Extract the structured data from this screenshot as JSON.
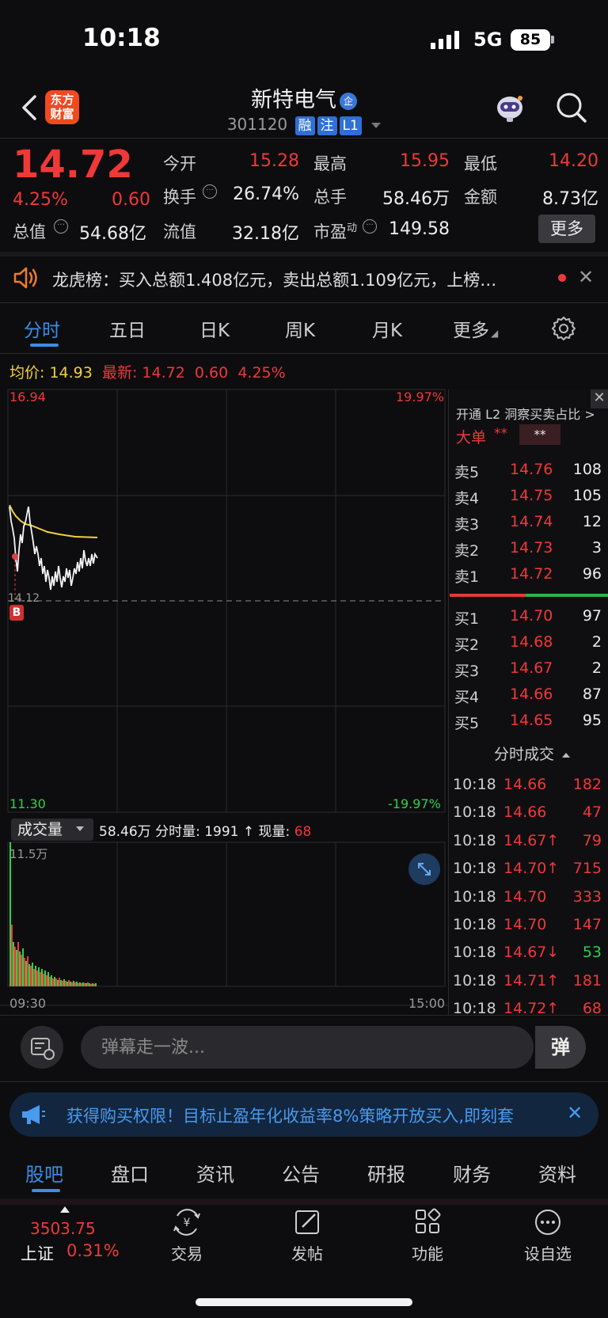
{
  "status": {
    "time": "10:18",
    "network": "5G",
    "battery": "85"
  },
  "header": {
    "logo_line1": "东方",
    "logo_line2": "财富",
    "stock_name": "新特电气",
    "enterprise_badge": "企",
    "stock_code": "301120",
    "tags": [
      "融",
      "注",
      "L1"
    ]
  },
  "quote": {
    "price": "14.72",
    "change_pct": "4.25%",
    "change": "0.60",
    "open_label": "今开",
    "open": "15.28",
    "high_label": "最高",
    "high": "15.95",
    "low_label": "最低",
    "low": "14.20",
    "turnover_label": "换手",
    "turnover": "26.74%",
    "volume_label": "总手",
    "volume": "58.46万",
    "amount_label": "金额",
    "amount": "8.73亿",
    "market_cap_label": "总值",
    "market_cap": "54.68亿",
    "float_cap_label": "流值",
    "float_cap": "32.18亿",
    "pe_label": "市盈",
    "pe_sup": "动",
    "pe": "149.58",
    "more_label": "更多"
  },
  "dragon_tiger": {
    "text": "龙虎榜：买入总额1.408亿元，卖出总额1.109亿元，上榜…"
  },
  "period_tabs": [
    "分时",
    "五日",
    "日K",
    "周K",
    "月K",
    "更多"
  ],
  "info_line": {
    "avg_label": "均价:",
    "avg": "14.93",
    "latest_label": "最新:",
    "latest": "14.72",
    "chg": "0.60",
    "pct": "4.25%"
  },
  "chart": {
    "y_max": "16.94",
    "y_max_pct": "19.97%",
    "y_min": "11.30",
    "y_min_pct": "-19.97%",
    "y_ref": "14.12",
    "b_marker": "B",
    "vol_select": "成交量",
    "vol_total": "58.46万",
    "vol_minute_label": "分时量:",
    "vol_minute": "1991",
    "vol_now_label": "现量:",
    "vol_now": "68",
    "vol_max": "11.5万",
    "time_start": "09:30",
    "time_end": "15:00"
  },
  "order_book": {
    "l2_promo": "开通 L2 洞察买卖占比 >",
    "big_order_label": "大单",
    "big_order_a": "**",
    "big_order_b": "**",
    "asks": [
      {
        "label": "卖5",
        "price": "14.76",
        "vol": "108"
      },
      {
        "label": "卖4",
        "price": "14.75",
        "vol": "105"
      },
      {
        "label": "卖3",
        "price": "14.74",
        "vol": "12"
      },
      {
        "label": "卖2",
        "price": "14.73",
        "vol": "3"
      },
      {
        "label": "卖1",
        "price": "14.72",
        "vol": "96"
      }
    ],
    "bids": [
      {
        "label": "买1",
        "price": "14.70",
        "vol": "97"
      },
      {
        "label": "买2",
        "price": "14.68",
        "vol": "2"
      },
      {
        "label": "买3",
        "price": "14.67",
        "vol": "2"
      },
      {
        "label": "买4",
        "price": "14.66",
        "vol": "87"
      },
      {
        "label": "买5",
        "price": "14.65",
        "vol": "95"
      }
    ],
    "trades_title": "分时成交",
    "trades": [
      {
        "time": "10:18",
        "price": "14.66",
        "vol": "182",
        "dir": "",
        "color": "#f03838"
      },
      {
        "time": "10:18",
        "price": "14.66",
        "vol": "47",
        "dir": "",
        "color": "#f03838"
      },
      {
        "time": "10:18",
        "price": "14.67↑",
        "vol": "79",
        "dir": "up",
        "color": "#f03838"
      },
      {
        "time": "10:18",
        "price": "14.70↑",
        "vol": "715",
        "dir": "up",
        "color": "#f03838"
      },
      {
        "time": "10:18",
        "price": "14.70",
        "vol": "333",
        "dir": "",
        "color": "#f03838"
      },
      {
        "time": "10:18",
        "price": "14.70",
        "vol": "147",
        "dir": "",
        "color": "#f03838"
      },
      {
        "time": "10:18",
        "price": "14.67↓",
        "vol": "53",
        "dir": "down",
        "color": "#2ed04a"
      },
      {
        "time": "10:18",
        "price": "14.71↑",
        "vol": "181",
        "dir": "up",
        "color": "#f03838"
      },
      {
        "time": "10:18",
        "price": "14.72↑",
        "vol": "68",
        "dir": "up",
        "color": "#f03838"
      }
    ]
  },
  "danmaku": {
    "placeholder": "弹幕走一波...",
    "send": "弹"
  },
  "promo": {
    "text": "获得购买权限！目标止盈年化收益率8%策略开放买入,即刻套"
  },
  "bottom_tabs": [
    "股吧",
    "盘口",
    "资讯",
    "公告",
    "研报",
    "财务",
    "资料"
  ],
  "bottom_nav": {
    "index_value": "3503.75",
    "index_name": "上证",
    "index_pct": "0.31%",
    "items": [
      "交易",
      "发帖",
      "功能",
      "设自选"
    ]
  },
  "colors": {
    "up": "#f03838",
    "down": "#2ed04a",
    "accent": "#3a8ee8",
    "avg_line": "#f0d040"
  }
}
